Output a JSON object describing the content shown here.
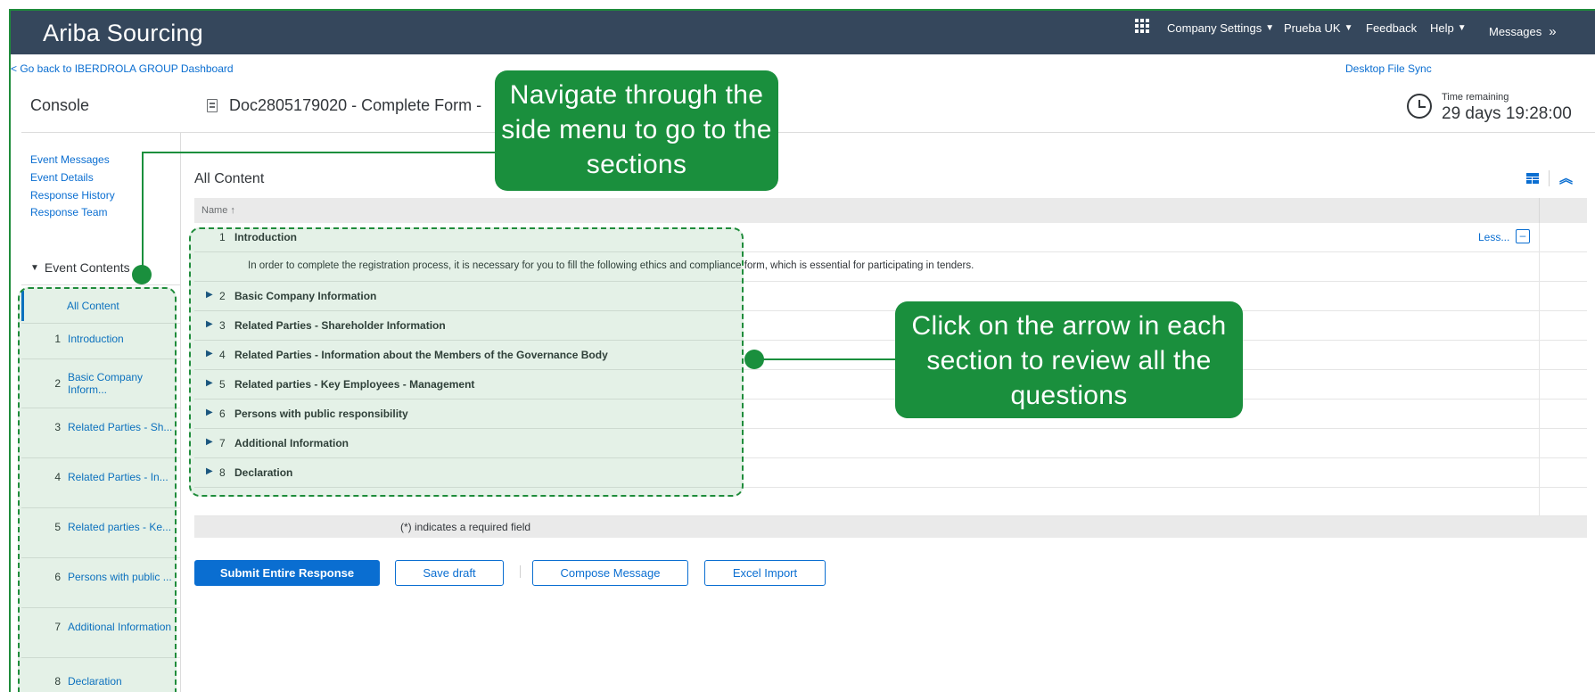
{
  "app_title": "Ariba Sourcing",
  "topnav": {
    "company_settings": "Company Settings",
    "prueba": "Prueba UK",
    "feedback": "Feedback",
    "help": "Help",
    "messages": "Messages",
    "messages_icon": "double-chevron-right-icon"
  },
  "back_link": "< Go back to IBERDROLA GROUP Dashboard",
  "desktop_sync": "Desktop File Sync",
  "console_title": "Console",
  "doc_title": "Doc2805179020 - Complete Form -",
  "time_remaining": {
    "label": "Time remaining",
    "value": "29 days 19:28:00"
  },
  "side_links": [
    "Event Messages",
    "Event Details",
    "Response History",
    "Response Team"
  ],
  "event_contents": {
    "caret": "▼",
    "label": "Event Contents"
  },
  "nav_all_content": "All Content",
  "nav_items": [
    {
      "num": "1",
      "label": "Introduction"
    },
    {
      "num": "2",
      "label": "Basic Company Inform..."
    },
    {
      "num": "3",
      "label": "Related Parties - Sh..."
    },
    {
      "num": "4",
      "label": "Related Parties - In..."
    },
    {
      "num": "5",
      "label": "Related parties - Ke..."
    },
    {
      "num": "6",
      "label": "Persons with public ..."
    },
    {
      "num": "7",
      "label": "Additional Information"
    },
    {
      "num": "8",
      "label": "Declaration"
    }
  ],
  "content_title": "All Content",
  "table_header": "Name ↑",
  "rows": [
    {
      "num": "1",
      "title": "Introduction"
    },
    {
      "num": "2",
      "title": "Basic Company Information"
    },
    {
      "num": "3",
      "title": "Related Parties - Shareholder Information"
    },
    {
      "num": "4",
      "title": "Related Parties - Information about the Members of the Governance Body"
    },
    {
      "num": "5",
      "title": "Related parties - Key Employees - Management"
    },
    {
      "num": "6",
      "title": "Persons with public responsibility"
    },
    {
      "num": "7",
      "title": "Additional Information"
    },
    {
      "num": "8",
      "title": "Declaration"
    }
  ],
  "row_arrow": "▶",
  "intro_text": "In order to complete the registration process, it is necessary for you to fill the following ethics and compliance form, which is essential for participating in tenders.",
  "less_link": "Less...",
  "less_toggle": "–",
  "required_note": "(*) indicates a required field",
  "buttons": {
    "submit": "Submit Entire Response",
    "save_draft": "Save draft",
    "compose": "Compose Message",
    "excel_import": "Excel Import"
  },
  "callouts": {
    "side_menu": "Navigate through the side menu to go to the sections",
    "arrow": "Click on the arrow in each section to review all the questions"
  },
  "colors": {
    "topbar": "#35475c",
    "accent": "#0a6ed1",
    "callout": "#1a8f3d"
  }
}
